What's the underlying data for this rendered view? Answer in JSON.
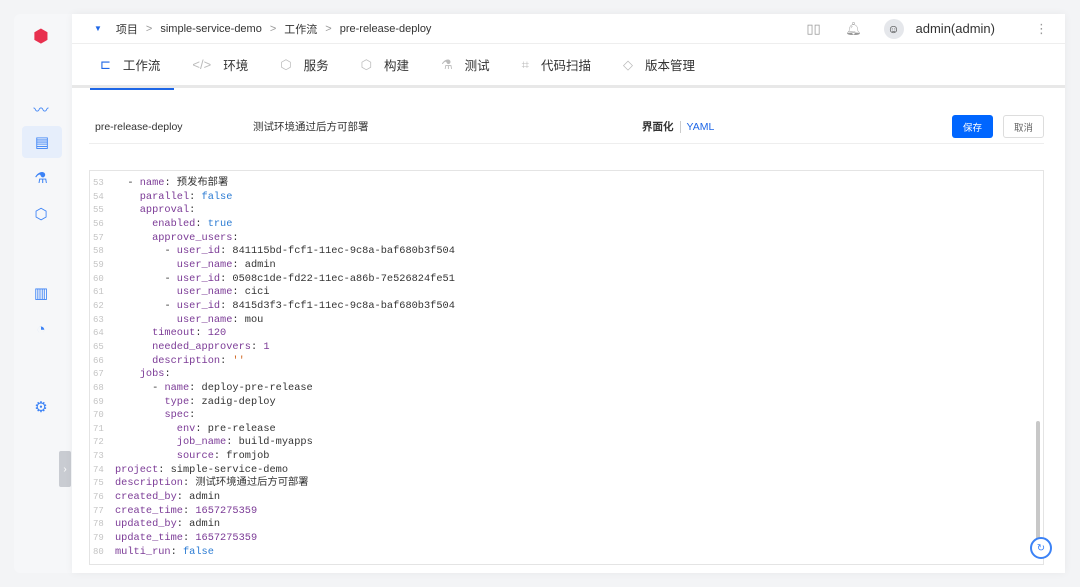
{
  "sidebar": {
    "items": [
      {
        "icon": "monitor-icon"
      },
      {
        "icon": "project-pm-icon",
        "active": true
      },
      {
        "icon": "flask-icon"
      },
      {
        "icon": "package-icon"
      },
      {
        "icon": "dashboard-icon"
      },
      {
        "icon": "pie-chart-icon"
      },
      {
        "icon": "settings-icon"
      }
    ]
  },
  "breadcrumb": [
    "项目",
    "simple-service-demo",
    "工作流",
    "pre-release-deploy"
  ],
  "header": {
    "user": "admin(admin)"
  },
  "tabs": [
    {
      "label": "工作流",
      "icon": "⊏",
      "active": true
    },
    {
      "label": "环境",
      "icon": "</>"
    },
    {
      "label": "服务",
      "icon": "⬡"
    },
    {
      "label": "构建",
      "icon": "⬡"
    },
    {
      "label": "测试",
      "icon": "⚗"
    },
    {
      "label": "代码扫描",
      "icon": "⌗"
    },
    {
      "label": "版本管理",
      "icon": "◇"
    }
  ],
  "toolbar": {
    "workflow_name": "pre-release-deploy",
    "description": "测试环境通过后方可部署",
    "mode_ui": "界面化",
    "mode_yaml": "YAML",
    "save": "保存",
    "cancel": "取消"
  },
  "code": [
    {
      "n": "53",
      "i": 2,
      "d": "- ",
      "k": "name",
      "v": "预发布部署",
      "t": "v"
    },
    {
      "n": "54",
      "i": 4,
      "k": "parallel",
      "v": "false",
      "t": "b"
    },
    {
      "n": "55",
      "i": 4,
      "k": "approval",
      "v": "",
      "t": "v"
    },
    {
      "n": "56",
      "i": 6,
      "k": "enabled",
      "v": "true",
      "t": "b"
    },
    {
      "n": "57",
      "i": 6,
      "k": "approve_users",
      "v": "",
      "t": "v"
    },
    {
      "n": "58",
      "i": 8,
      "d": "- ",
      "k": "user_id",
      "v": "841115bd-fcf1-11ec-9c8a-baf680b3f504",
      "t": "v"
    },
    {
      "n": "59",
      "i": 10,
      "k": "user_name",
      "v": "admin",
      "t": "v"
    },
    {
      "n": "60",
      "i": 8,
      "d": "- ",
      "k": "user_id",
      "v": "0508c1de-fd22-11ec-a86b-7e526824fe51",
      "t": "v"
    },
    {
      "n": "61",
      "i": 10,
      "k": "user_name",
      "v": "cici",
      "t": "v"
    },
    {
      "n": "62",
      "i": 8,
      "d": "- ",
      "k": "user_id",
      "v": "8415d3f3-fcf1-11ec-9c8a-baf680b3f504",
      "t": "v"
    },
    {
      "n": "63",
      "i": 10,
      "k": "user_name",
      "v": "mou",
      "t": "v"
    },
    {
      "n": "64",
      "i": 6,
      "k": "timeout",
      "v": "120",
      "t": "n"
    },
    {
      "n": "65",
      "i": 6,
      "k": "needed_approvers",
      "v": "1",
      "t": "n"
    },
    {
      "n": "66",
      "i": 6,
      "k": "description",
      "v": "''",
      "t": "s"
    },
    {
      "n": "67",
      "i": 4,
      "k": "jobs",
      "v": "",
      "t": "v"
    },
    {
      "n": "68",
      "i": 6,
      "d": "- ",
      "k": "name",
      "v": "deploy-pre-release",
      "t": "v"
    },
    {
      "n": "69",
      "i": 8,
      "k": "type",
      "v": "zadig-deploy",
      "t": "v"
    },
    {
      "n": "70",
      "i": 8,
      "k": "spec",
      "v": "",
      "t": "v"
    },
    {
      "n": "71",
      "i": 10,
      "k": "env",
      "v": "pre-release",
      "t": "v"
    },
    {
      "n": "72",
      "i": 10,
      "k": "job_name",
      "v": "build-myapps",
      "t": "v"
    },
    {
      "n": "73",
      "i": 10,
      "k": "source",
      "v": "fromjob",
      "t": "v"
    },
    {
      "n": "74",
      "i": 0,
      "k": "project",
      "v": "simple-service-demo",
      "t": "v"
    },
    {
      "n": "75",
      "i": 0,
      "k": "description",
      "v": "测试环境通过后方可部署",
      "t": "v"
    },
    {
      "n": "76",
      "i": 0,
      "k": "created_by",
      "v": "admin",
      "t": "v"
    },
    {
      "n": "77",
      "i": 0,
      "k": "create_time",
      "v": "1657275359",
      "t": "n"
    },
    {
      "n": "78",
      "i": 0,
      "k": "updated_by",
      "v": "admin",
      "t": "v"
    },
    {
      "n": "79",
      "i": 0,
      "k": "update_time",
      "v": "1657275359",
      "t": "n"
    },
    {
      "n": "80",
      "i": 0,
      "k": "multi_run",
      "v": "false",
      "t": "b"
    }
  ]
}
